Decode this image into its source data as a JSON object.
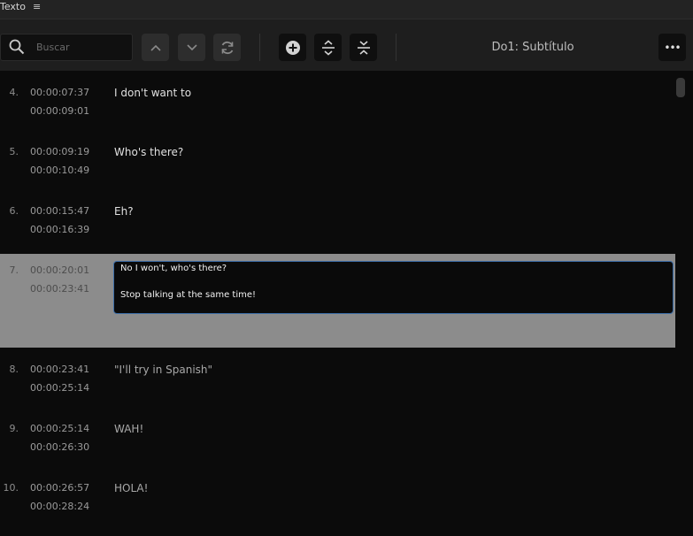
{
  "panel": {
    "title": "Texto",
    "menu_icon": "≡"
  },
  "toolbar": {
    "search_placeholder": "Buscar",
    "track_label": "Do1: Subtítulo",
    "more_icon": "•••"
  },
  "rows": [
    {
      "num": "4.",
      "in": "00:00:07:37",
      "out": "00:00:09:01",
      "text": "I don't want to"
    },
    {
      "num": "5.",
      "in": "00:00:09:19",
      "out": "00:00:10:49",
      "text": "Who's there?"
    },
    {
      "num": "6.",
      "in": "00:00:15:47",
      "out": "00:00:16:39",
      "text": "Eh?"
    },
    {
      "num": "7.",
      "in": "00:00:20:01",
      "out": "00:00:23:41",
      "line1": "No I won't, who's there?",
      "line2": "Stop talking at the same time!"
    },
    {
      "num": "8.",
      "in": "00:00:23:41",
      "out": "00:00:25:14",
      "text": "\"I'll try in Spanish\""
    },
    {
      "num": "9.",
      "in": "00:00:25:14",
      "out": "00:00:26:30",
      "text": "WAH!"
    },
    {
      "num": "10.",
      "in": "00:00:26:57",
      "out": "00:00:28:24",
      "text": "HOLA!"
    }
  ]
}
